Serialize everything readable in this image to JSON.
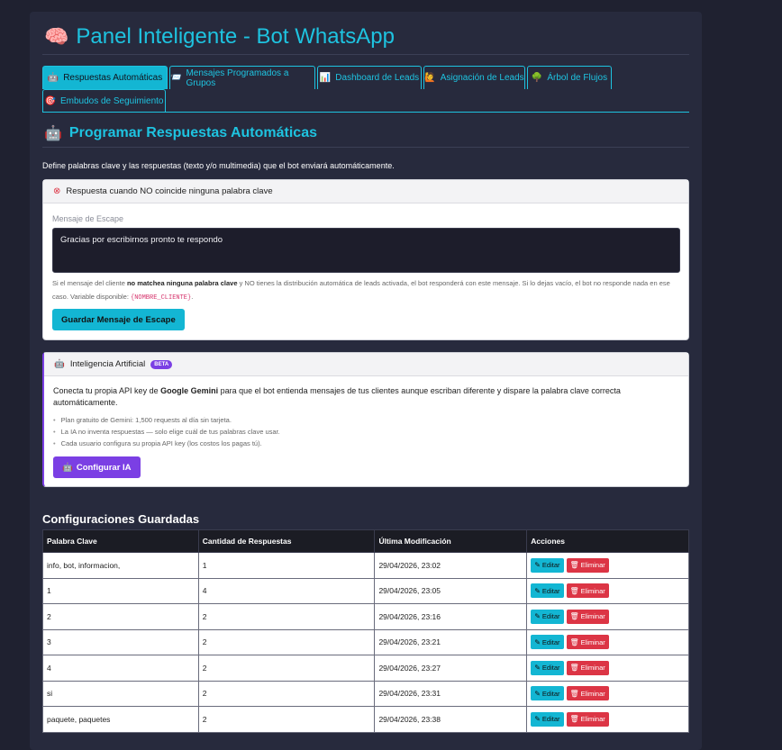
{
  "header": {
    "icon": "brain-icon",
    "title": "Panel Inteligente - Bot WhatsApp"
  },
  "tabs": [
    {
      "icon": "robot-icon",
      "label": "Respuestas Automáticas",
      "active": true
    },
    {
      "icon": "mailbox-icon",
      "label": "Mensajes Programados a Grupos",
      "active": false
    },
    {
      "icon": "chart-icon",
      "label": "Dashboard de Leads",
      "active": false
    },
    {
      "icon": "person-icon",
      "label": "Asignación de Leads",
      "active": false
    },
    {
      "icon": "tree-icon",
      "label": "Árbol de Flujos",
      "active": false
    },
    {
      "icon": "funnel-icon",
      "label": "Embudos de Seguimiento",
      "active": false
    }
  ],
  "section": {
    "icon": "robot-icon",
    "title": "Programar Respuestas Automáticas",
    "intro": "Define palabras clave y las respuestas (texto y/o multimedia) que el bot enviará automáticamente."
  },
  "escape_card": {
    "header": "Respuesta cuando NO coincide ninguna palabra clave",
    "field_label": "Mensaje de Escape",
    "field_value": "Gracias por escribirnos pronto te respondo",
    "help_part1": "Si el mensaje del cliente ",
    "help_bold": "no matchea ninguna palabra clave",
    "help_part2": " y NO tienes la distribución automática de leads activada, el bot responderá con este mensaje. Si lo dejas vacío, el bot no responde nada en ese caso. Variable disponible: ",
    "help_code": "{NOMBRE_CLIENTE}",
    "help_end": ".",
    "button": "Guardar Mensaje de Escape"
  },
  "ai_card": {
    "header": "Inteligencia Artificial",
    "badge": "BETA",
    "desc_part1": "Conecta tu propia API key de ",
    "desc_bold": "Google Gemini",
    "desc_part2": " para que el bot entienda mensajes de tus clientes aunque escriban diferente y dispare la palabra clave correcta automáticamente.",
    "bullets": [
      "Plan gratuito de Gemini: 1,500 requests al día sin tarjeta.",
      "La IA no inventa respuestas — solo elige cuál de tus palabras clave usar.",
      "Cada usuario configura su propia API key (los costos los pagas tú)."
    ],
    "button": "Configurar IA"
  },
  "saved": {
    "title": "Configuraciones Guardadas",
    "columns": [
      "Palabra Clave",
      "Cantidad de Respuestas",
      "Última Modificación",
      "Acciones"
    ],
    "edit_label": "Editar",
    "delete_label": "Eliminar",
    "rows": [
      [
        "info, bot, informacion,",
        "1",
        "29/04/2026, 23:02"
      ],
      [
        "1",
        "4",
        "29/04/2026, 23:05"
      ],
      [
        "2",
        "2",
        "29/04/2026, 23:16"
      ],
      [
        "3",
        "2",
        "29/04/2026, 23:21"
      ],
      [
        "4",
        "2",
        "29/04/2026, 23:27"
      ],
      [
        "si",
        "2",
        "29/04/2026, 23:31"
      ],
      [
        "paquete, paquetes",
        "2",
        "29/04/2026, 23:38"
      ]
    ]
  }
}
